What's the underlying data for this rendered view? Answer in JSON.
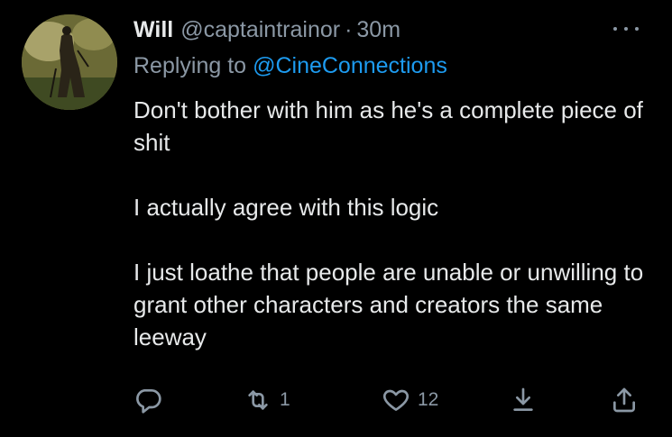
{
  "tweet": {
    "display_name": "Will",
    "handle": "@captaintrainor",
    "separator": "·",
    "time": "30m",
    "replying_prefix": "Replying to",
    "replying_to": "@CineConnections",
    "paragraphs": [
      "Don't bother with him as he's a complete piece of shit",
      "I actually agree with this logic",
      "I just loathe that people are unable or unwilling to grant other characters and creators the same leeway"
    ]
  },
  "actions": {
    "reply_icon": "reply-icon",
    "retweet_icon": "retweet-icon",
    "retweet_count": "1",
    "like_icon": "heart-icon",
    "like_count": "12",
    "download_icon": "download-icon",
    "share_icon": "share-icon"
  },
  "colors": {
    "background": "#000000",
    "text": "#e7e9ea",
    "muted": "#8b98a5",
    "link": "#1d9bf0"
  }
}
